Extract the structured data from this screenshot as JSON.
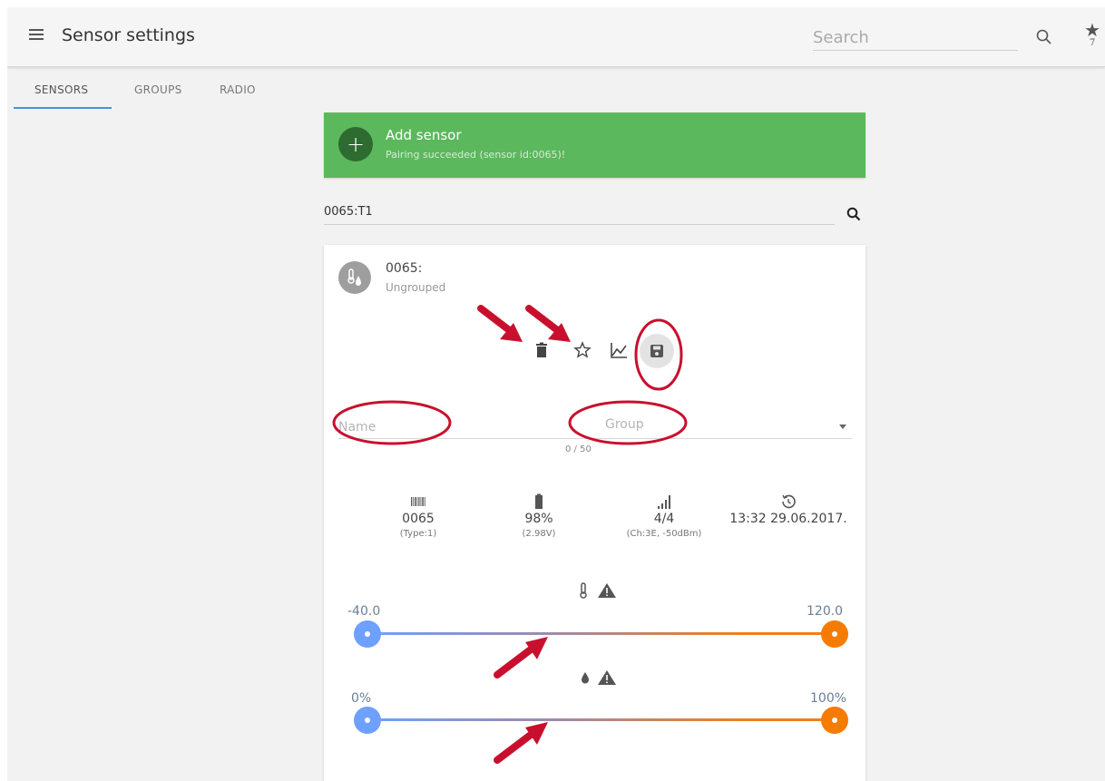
{
  "header": {
    "title": "Sensor settings",
    "search_placeholder": "Search",
    "favorites_count": "7"
  },
  "tabs": [
    {
      "label": "SENSORS",
      "active": true
    },
    {
      "label": "GROUPS",
      "active": false
    },
    {
      "label": "RADIO",
      "active": false
    }
  ],
  "banner": {
    "title": "Add sensor",
    "subtitle": "Pairing succeeded (sensor id:0065)!",
    "color": "#5cb85c"
  },
  "filter": {
    "value": "0065:T1"
  },
  "sensor": {
    "id_label": "0065:",
    "group_label": "Ungrouped",
    "name_placeholder": "Name",
    "name_counter": "0 / 50",
    "group_placeholder": "Group",
    "info": {
      "serial": {
        "icon": "barcode-icon",
        "value": "0065",
        "sub": "(Type:1)"
      },
      "battery": {
        "icon": "battery-icon",
        "value": "98%",
        "sub": "(2.98V)"
      },
      "signal": {
        "icon": "signal-icon",
        "value": "4/4",
        "sub": "(Ch:3E, -50dBm)"
      },
      "last_seen": {
        "icon": "history-icon",
        "value": "13:32 29.06.2017.",
        "sub": ""
      }
    },
    "temperature_range": {
      "min_label": "-40.0",
      "max_label": "120.0"
    },
    "humidity_range": {
      "min_label": "0%",
      "max_label": "100%"
    }
  },
  "colors": {
    "accent_tab": "#4a90e2",
    "slider_low": "#6ea0ff",
    "slider_high": "#f57c00",
    "annotation": "#c8102e"
  }
}
